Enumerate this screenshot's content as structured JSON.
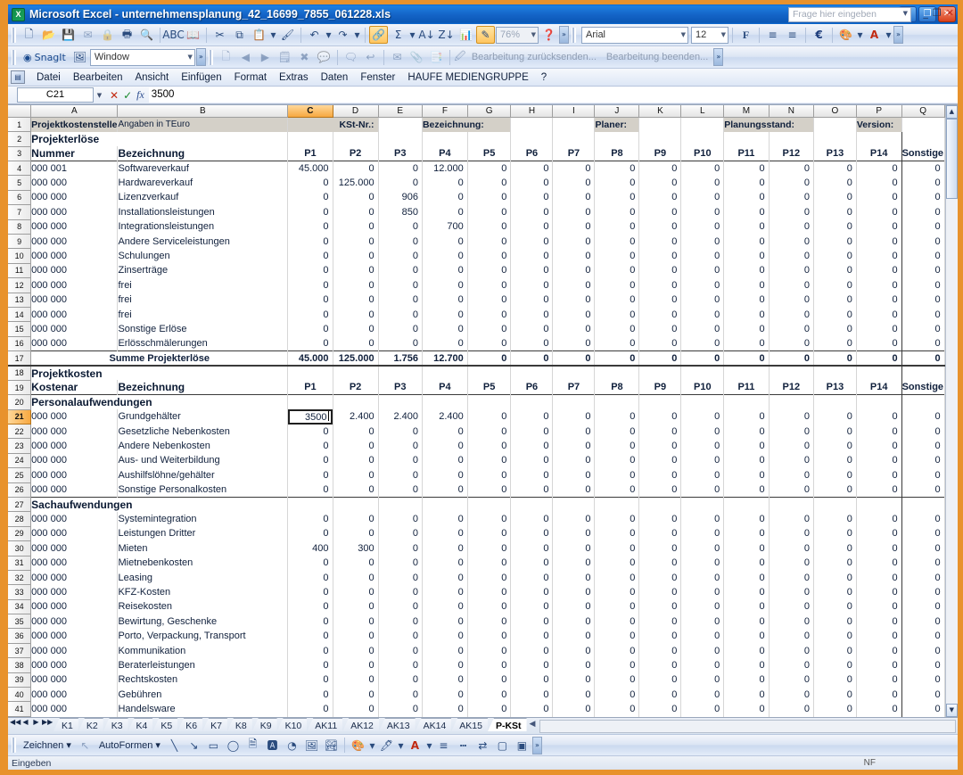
{
  "window": {
    "title": "Microsoft Excel - unternehmensplanung_42_16699_7855_061228.xls",
    "minimize": "_",
    "restore": "❐",
    "close": "✕"
  },
  "menubar": {
    "items": [
      "Datei",
      "Bearbeiten",
      "Ansicht",
      "Einfügen",
      "Format",
      "Extras",
      "Daten",
      "Fenster",
      "HAUFE MEDIENGRUPPE",
      "?"
    ],
    "ask_placeholder": "Frage hier eingeben",
    "doc_minimize": "_",
    "doc_restore": "❐",
    "doc_close": "✕"
  },
  "toolbar_standard": {
    "zoom_value": "76%",
    "font_name": "Arial",
    "font_size": "12",
    "bold_label": "F",
    "currency_label": "€",
    "font_color_label": "A"
  },
  "toolbar_snagit": {
    "label": "SnagIt",
    "profile": "Window"
  },
  "toolbar_review": {
    "send_back": "Bearbeitung zurücksenden...",
    "finish": "Bearbeitung beenden..."
  },
  "formula_bar": {
    "name_box": "C21",
    "cancel": "✕",
    "accept": "✓",
    "fx": "fx",
    "formula": "3500"
  },
  "grid": {
    "columns": [
      "A",
      "B",
      "C",
      "D",
      "E",
      "F",
      "G",
      "H",
      "I",
      "J",
      "K",
      "L",
      "M",
      "N",
      "O",
      "P",
      "Q"
    ],
    "selected_column": "C",
    "selected_row": 21,
    "row_numbers": [
      1,
      2,
      3,
      4,
      5,
      6,
      7,
      8,
      9,
      10,
      11,
      12,
      13,
      14,
      15,
      16,
      17,
      18,
      19,
      20,
      21,
      22,
      23,
      24,
      25,
      26,
      27,
      28,
      29,
      30,
      31,
      32,
      33,
      34,
      35,
      36,
      37,
      38,
      39,
      40,
      41
    ],
    "header_row": {
      "title": "Projektkostenstelle",
      "subtitle": "Angaben in TEuro",
      "kst_label": "KSt-Nr.:",
      "bezeichnung_label": "Bezeichnung:",
      "planer_label": "Planer:",
      "planungsstand_label": "Planungsstand:",
      "version_label": "Version:"
    },
    "section_erloese": "Projekterlöse",
    "section_kosten": "Projektkosten",
    "col_header_nummer": "Nummer",
    "col_header_kostenart": "Kostenar",
    "col_header_bezeichnung": "Bezeichnung",
    "period_headers": [
      "P1",
      "P2",
      "P3",
      "P4",
      "P5",
      "P6",
      "P7",
      "P8",
      "P9",
      "P10",
      "P11",
      "P12",
      "P13",
      "P14",
      "Sonstige"
    ],
    "group_personal": "Personalaufwendungen",
    "group_sach": "Sachaufwendungen",
    "sum_label": "Summe Projekterlöse",
    "erloese_rows": [
      {
        "row": 4,
        "nr": "000 001",
        "name": "Softwareverkauf",
        "values": [
          "45.000",
          "0",
          "0",
          "12.000",
          "0",
          "0",
          "0",
          "0",
          "0",
          "0",
          "0",
          "0",
          "0",
          "0",
          "0"
        ]
      },
      {
        "row": 5,
        "nr": "000 000",
        "name": "Hardwareverkauf",
        "values": [
          "0",
          "125.000",
          "0",
          "0",
          "0",
          "0",
          "0",
          "0",
          "0",
          "0",
          "0",
          "0",
          "0",
          "0",
          "0"
        ]
      },
      {
        "row": 6,
        "nr": "000 000",
        "name": "Lizenzverkauf",
        "values": [
          "0",
          "0",
          "906",
          "0",
          "0",
          "0",
          "0",
          "0",
          "0",
          "0",
          "0",
          "0",
          "0",
          "0",
          "0"
        ]
      },
      {
        "row": 7,
        "nr": "000 000",
        "name": "Installationsleistungen",
        "values": [
          "0",
          "0",
          "850",
          "0",
          "0",
          "0",
          "0",
          "0",
          "0",
          "0",
          "0",
          "0",
          "0",
          "0",
          "0"
        ]
      },
      {
        "row": 8,
        "nr": "000 000",
        "name": "Integrationsleistungen",
        "values": [
          "0",
          "0",
          "0",
          "700",
          "0",
          "0",
          "0",
          "0",
          "0",
          "0",
          "0",
          "0",
          "0",
          "0",
          "0"
        ]
      },
      {
        "row": 9,
        "nr": "000 000",
        "name": "Andere Serviceleistungen",
        "values": [
          "0",
          "0",
          "0",
          "0",
          "0",
          "0",
          "0",
          "0",
          "0",
          "0",
          "0",
          "0",
          "0",
          "0",
          "0"
        ]
      },
      {
        "row": 10,
        "nr": "000 000",
        "name": "Schulungen",
        "values": [
          "0",
          "0",
          "0",
          "0",
          "0",
          "0",
          "0",
          "0",
          "0",
          "0",
          "0",
          "0",
          "0",
          "0",
          "0"
        ]
      },
      {
        "row": 11,
        "nr": "000 000",
        "name": "Zinserträge",
        "values": [
          "0",
          "0",
          "0",
          "0",
          "0",
          "0",
          "0",
          "0",
          "0",
          "0",
          "0",
          "0",
          "0",
          "0",
          "0"
        ]
      },
      {
        "row": 12,
        "nr": "000 000",
        "name": "frei",
        "values": [
          "0",
          "0",
          "0",
          "0",
          "0",
          "0",
          "0",
          "0",
          "0",
          "0",
          "0",
          "0",
          "0",
          "0",
          "0"
        ]
      },
      {
        "row": 13,
        "nr": "000 000",
        "name": "frei",
        "values": [
          "0",
          "0",
          "0",
          "0",
          "0",
          "0",
          "0",
          "0",
          "0",
          "0",
          "0",
          "0",
          "0",
          "0",
          "0"
        ]
      },
      {
        "row": 14,
        "nr": "000 000",
        "name": "frei",
        "values": [
          "0",
          "0",
          "0",
          "0",
          "0",
          "0",
          "0",
          "0",
          "0",
          "0",
          "0",
          "0",
          "0",
          "0",
          "0"
        ]
      },
      {
        "row": 15,
        "nr": "000 000",
        "name": "Sonstige Erlöse",
        "values": [
          "0",
          "0",
          "0",
          "0",
          "0",
          "0",
          "0",
          "0",
          "0",
          "0",
          "0",
          "0",
          "0",
          "0",
          "0"
        ]
      },
      {
        "row": 16,
        "nr": "000 000",
        "name": "Erlösschmälerungen",
        "values": [
          "0",
          "0",
          "0",
          "0",
          "0",
          "0",
          "0",
          "0",
          "0",
          "0",
          "0",
          "0",
          "0",
          "0",
          "0"
        ]
      }
    ],
    "sum_values": [
      "45.000",
      "125.000",
      "1.756",
      "12.700",
      "0",
      "0",
      "0",
      "0",
      "0",
      "0",
      "0",
      "0",
      "0",
      "0",
      "0"
    ],
    "personal_rows": [
      {
        "row": 21,
        "nr": "000 000",
        "name": "Grundgehälter",
        "values": [
          "3500",
          "2.400",
          "2.400",
          "2.400",
          "0",
          "0",
          "0",
          "0",
          "0",
          "0",
          "0",
          "0",
          "0",
          "0",
          "0"
        ],
        "editing": true
      },
      {
        "row": 22,
        "nr": "000 000",
        "name": "Gesetzliche Nebenkosten",
        "values": [
          "0",
          "0",
          "0",
          "0",
          "0",
          "0",
          "0",
          "0",
          "0",
          "0",
          "0",
          "0",
          "0",
          "0",
          "0"
        ]
      },
      {
        "row": 23,
        "nr": "000 000",
        "name": "Andere Nebenkosten",
        "values": [
          "0",
          "0",
          "0",
          "0",
          "0",
          "0",
          "0",
          "0",
          "0",
          "0",
          "0",
          "0",
          "0",
          "0",
          "0"
        ]
      },
      {
        "row": 24,
        "nr": "000 000",
        "name": "Aus- und Weiterbildung",
        "values": [
          "0",
          "0",
          "0",
          "0",
          "0",
          "0",
          "0",
          "0",
          "0",
          "0",
          "0",
          "0",
          "0",
          "0",
          "0"
        ]
      },
      {
        "row": 25,
        "nr": "000 000",
        "name": "Aushilfslöhne/gehälter",
        "values": [
          "0",
          "0",
          "0",
          "0",
          "0",
          "0",
          "0",
          "0",
          "0",
          "0",
          "0",
          "0",
          "0",
          "0",
          "0"
        ]
      },
      {
        "row": 26,
        "nr": "000 000",
        "name": "Sonstige Personalkosten",
        "values": [
          "0",
          "0",
          "0",
          "0",
          "0",
          "0",
          "0",
          "0",
          "0",
          "0",
          "0",
          "0",
          "0",
          "0",
          "0"
        ]
      }
    ],
    "sach_rows": [
      {
        "row": 28,
        "nr": "000 000",
        "name": "Systemintegration",
        "values": [
          "0",
          "0",
          "0",
          "0",
          "0",
          "0",
          "0",
          "0",
          "0",
          "0",
          "0",
          "0",
          "0",
          "0",
          "0"
        ]
      },
      {
        "row": 29,
        "nr": "000 000",
        "name": "Leistungen Dritter",
        "values": [
          "0",
          "0",
          "0",
          "0",
          "0",
          "0",
          "0",
          "0",
          "0",
          "0",
          "0",
          "0",
          "0",
          "0",
          "0"
        ]
      },
      {
        "row": 30,
        "nr": "000 000",
        "name": "Mieten",
        "values": [
          "400",
          "300",
          "0",
          "0",
          "0",
          "0",
          "0",
          "0",
          "0",
          "0",
          "0",
          "0",
          "0",
          "0",
          "0"
        ]
      },
      {
        "row": 31,
        "nr": "000 000",
        "name": "Mietnebenkosten",
        "values": [
          "0",
          "0",
          "0",
          "0",
          "0",
          "0",
          "0",
          "0",
          "0",
          "0",
          "0",
          "0",
          "0",
          "0",
          "0"
        ]
      },
      {
        "row": 32,
        "nr": "000 000",
        "name": "Leasing",
        "values": [
          "0",
          "0",
          "0",
          "0",
          "0",
          "0",
          "0",
          "0",
          "0",
          "0",
          "0",
          "0",
          "0",
          "0",
          "0"
        ]
      },
      {
        "row": 33,
        "nr": "000 000",
        "name": "KFZ-Kosten",
        "values": [
          "0",
          "0",
          "0",
          "0",
          "0",
          "0",
          "0",
          "0",
          "0",
          "0",
          "0",
          "0",
          "0",
          "0",
          "0"
        ]
      },
      {
        "row": 34,
        "nr": "000 000",
        "name": "Reisekosten",
        "values": [
          "0",
          "0",
          "0",
          "0",
          "0",
          "0",
          "0",
          "0",
          "0",
          "0",
          "0",
          "0",
          "0",
          "0",
          "0"
        ]
      },
      {
        "row": 35,
        "nr": "000 000",
        "name": "Bewirtung, Geschenke",
        "values": [
          "0",
          "0",
          "0",
          "0",
          "0",
          "0",
          "0",
          "0",
          "0",
          "0",
          "0",
          "0",
          "0",
          "0",
          "0"
        ]
      },
      {
        "row": 36,
        "nr": "000 000",
        "name": "Porto, Verpackung, Transport",
        "values": [
          "0",
          "0",
          "0",
          "0",
          "0",
          "0",
          "0",
          "0",
          "0",
          "0",
          "0",
          "0",
          "0",
          "0",
          "0"
        ]
      },
      {
        "row": 37,
        "nr": "000 000",
        "name": "Kommunikation",
        "values": [
          "0",
          "0",
          "0",
          "0",
          "0",
          "0",
          "0",
          "0",
          "0",
          "0",
          "0",
          "0",
          "0",
          "0",
          "0"
        ]
      },
      {
        "row": 38,
        "nr": "000 000",
        "name": "Beraterleistungen",
        "values": [
          "0",
          "0",
          "0",
          "0",
          "0",
          "0",
          "0",
          "0",
          "0",
          "0",
          "0",
          "0",
          "0",
          "0",
          "0"
        ]
      },
      {
        "row": 39,
        "nr": "000 000",
        "name": "Rechtskosten",
        "values": [
          "0",
          "0",
          "0",
          "0",
          "0",
          "0",
          "0",
          "0",
          "0",
          "0",
          "0",
          "0",
          "0",
          "0",
          "0"
        ]
      },
      {
        "row": 40,
        "nr": "000 000",
        "name": "Gebühren",
        "values": [
          "0",
          "0",
          "0",
          "0",
          "0",
          "0",
          "0",
          "0",
          "0",
          "0",
          "0",
          "0",
          "0",
          "0",
          "0"
        ]
      },
      {
        "row": 41,
        "nr": "000 000",
        "name": "Handelsware",
        "values": [
          "0",
          "0",
          "0",
          "0",
          "0",
          "0",
          "0",
          "0",
          "0",
          "0",
          "0",
          "0",
          "0",
          "0",
          "0"
        ]
      }
    ]
  },
  "tabs": {
    "items": [
      "K1",
      "K2",
      "K3",
      "K4",
      "K5",
      "K6",
      "K7",
      "K8",
      "K9",
      "K10",
      "AK11",
      "AK12",
      "AK13",
      "AK14",
      "AK15",
      "P-KSt"
    ],
    "active": "P-KSt",
    "nav_first": "◀◀",
    "nav_prev": "◀",
    "nav_next": "▶",
    "nav_last": "▶▶"
  },
  "drawbar": {
    "draw_label": "Zeichnen",
    "autoforms_label": "AutoFormen",
    "font_color_label": "A"
  },
  "statusbar": {
    "mode": "Eingeben",
    "num_lock": "NF"
  },
  "colors": {
    "title_blue": "#1565c8",
    "frame_orange": "#e8922c",
    "selection_orange": "#f7a840",
    "header_gray": "#d4d0c8",
    "text_navy": "#10203c"
  }
}
